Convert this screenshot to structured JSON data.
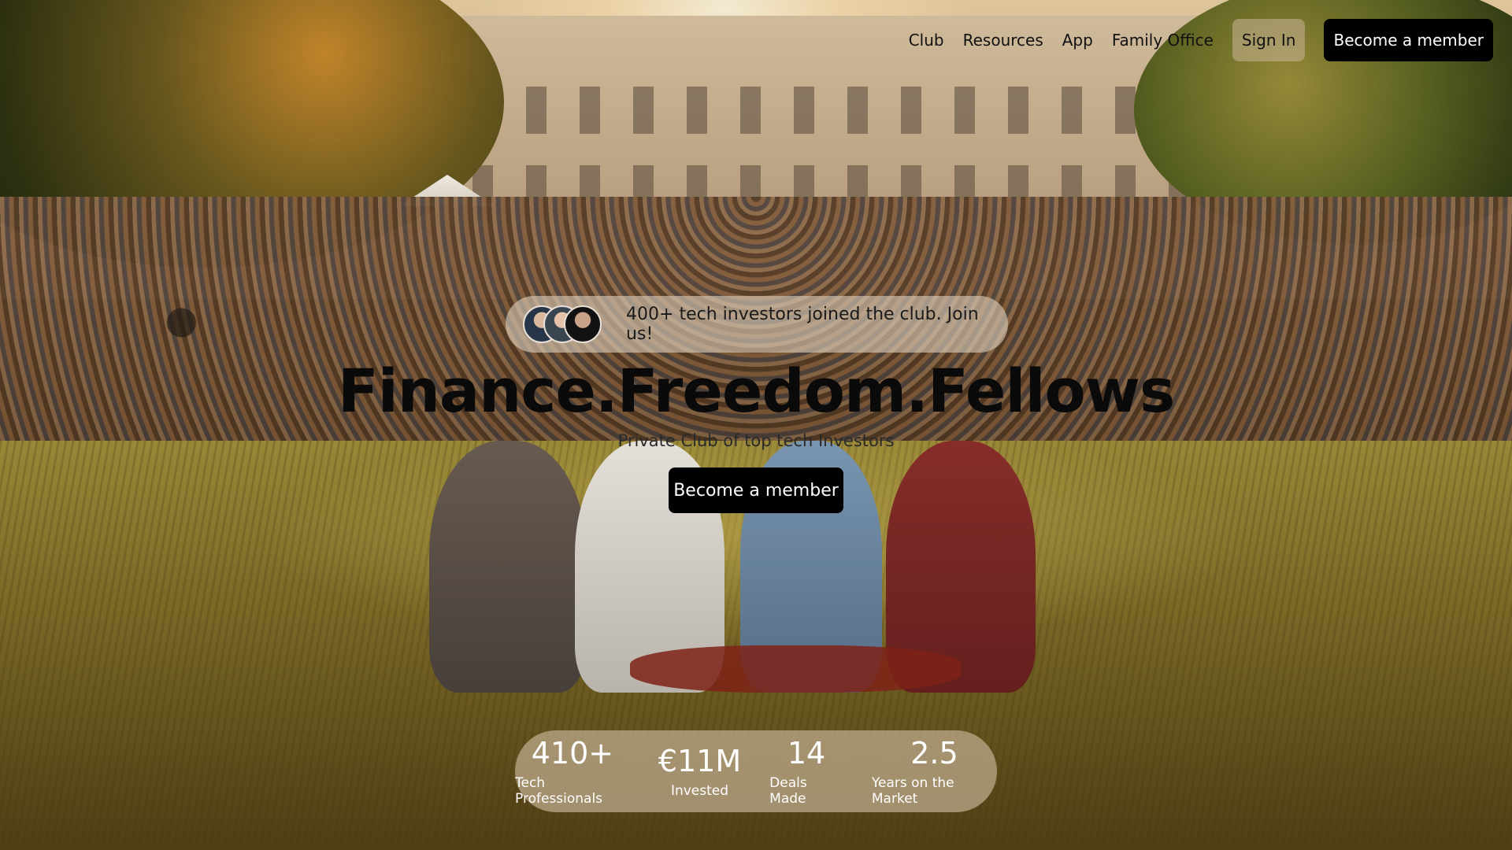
{
  "nav": {
    "links": [
      "Club",
      "Resources",
      "App",
      "Family Office"
    ],
    "sign_in": "Sign In",
    "cta": "Become a member"
  },
  "hero": {
    "social_proof": "400+ tech investors joined the club. Join us!",
    "title": "Finance.Freedom.Fellows",
    "subtitle": "Private Club of top tech Investors",
    "cta": "Become a member"
  },
  "stats": [
    {
      "value": "410+",
      "label": "Tech Professionals"
    },
    {
      "value": "€11M",
      "label": "Invested"
    },
    {
      "value": "14",
      "label": "Deals Made"
    },
    {
      "value": "2.5",
      "label": "Years on the Market"
    }
  ],
  "colors": {
    "cta_background": "#000000",
    "cta_text": "#ffffff",
    "title_text": "#0a0a0a"
  }
}
